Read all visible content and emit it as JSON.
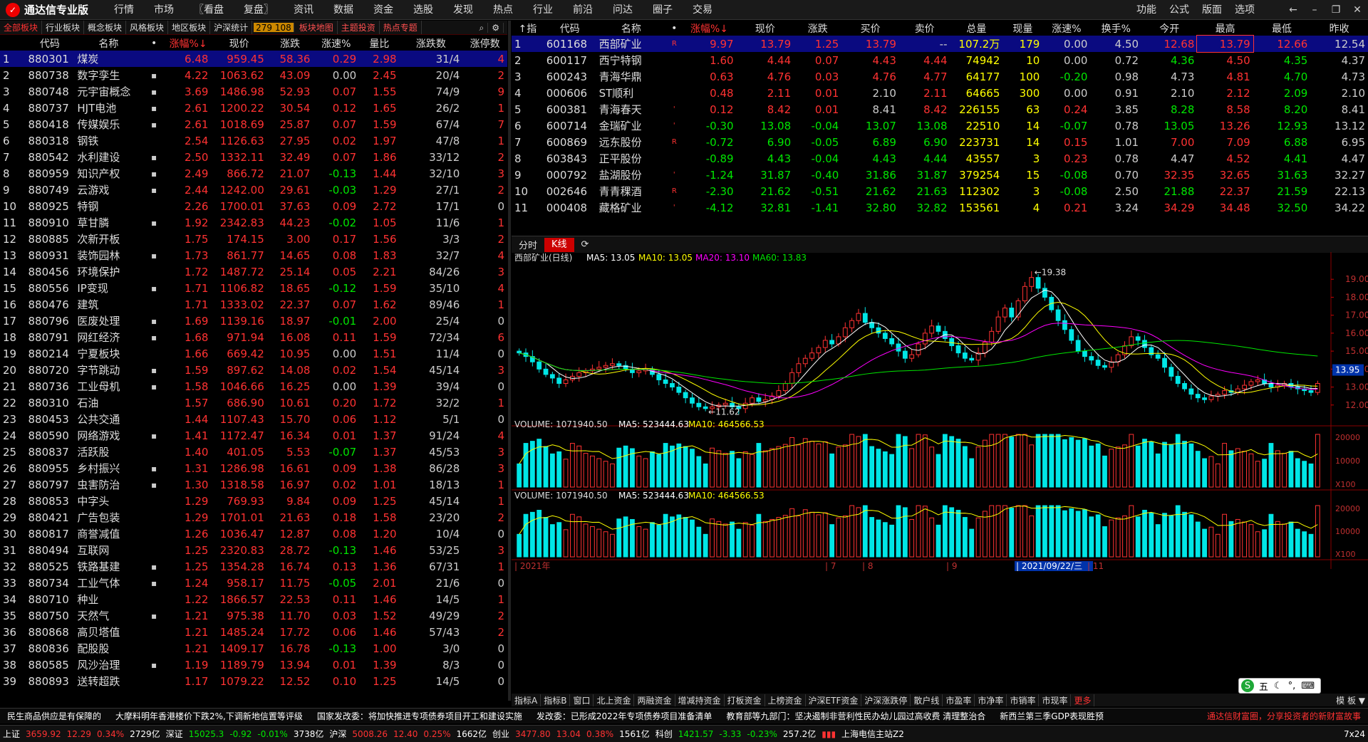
{
  "app": {
    "title": "通达信专业版",
    "logo_char": "✓"
  },
  "menu": [
    "行情",
    "市场",
    "〖看盘",
    "复盘〗",
    "资讯",
    "数据",
    "资金",
    "选股",
    "发现",
    "热点",
    "行业",
    "前沿",
    "问达",
    "圈子",
    "交易"
  ],
  "rmenu": [
    "功能",
    "公式",
    "版面",
    "选项"
  ],
  "tabs": [
    {
      "l": "全部板块",
      "act": true
    },
    {
      "l": "行业板块"
    },
    {
      "l": "概念板块"
    },
    {
      "l": "风格板块"
    },
    {
      "l": "地区板块"
    },
    {
      "l": "沪深统计"
    }
  ],
  "tab_count": "279 108",
  "tabs2": [
    "板块地图",
    "主题投资",
    "热点专题"
  ],
  "left": {
    "headers": [
      "",
      "代码",
      "名称",
      "•",
      "涨幅%↓",
      "现价",
      "涨跌",
      "涨速%",
      "量比",
      "涨跌数",
      "涨停数"
    ],
    "rows": [
      [
        "1",
        "880301",
        "煤炭",
        "",
        "6.48",
        "959.45",
        "58.36",
        "0.29",
        "2.98",
        "31/4",
        "4"
      ],
      [
        "2",
        "880738",
        "数字孪生",
        "▪",
        "4.22",
        "1063.62",
        "43.09",
        "0.00",
        "2.45",
        "20/4",
        "2"
      ],
      [
        "3",
        "880748",
        "元宇宙概念",
        "▪",
        "3.69",
        "1486.98",
        "52.93",
        "0.07",
        "1.55",
        "74/9",
        "9"
      ],
      [
        "4",
        "880737",
        "HJT电池",
        "▪",
        "2.61",
        "1200.22",
        "30.54",
        "0.12",
        "1.65",
        "26/2",
        "1"
      ],
      [
        "5",
        "880418",
        "传媒娱乐",
        "▪",
        "2.61",
        "1018.69",
        "25.87",
        "0.07",
        "1.59",
        "67/4",
        "7"
      ],
      [
        "6",
        "880318",
        "钢铁",
        "",
        "2.54",
        "1126.63",
        "27.95",
        "0.02",
        "1.97",
        "47/8",
        "1"
      ],
      [
        "7",
        "880542",
        "水利建设",
        "▪",
        "2.50",
        "1332.11",
        "32.49",
        "0.07",
        "1.86",
        "33/12",
        "2"
      ],
      [
        "8",
        "880959",
        "知识产权",
        "▪",
        "2.49",
        "866.72",
        "21.07",
        "-0.13",
        "1.44",
        "32/10",
        "3"
      ],
      [
        "9",
        "880749",
        "云游戏",
        "▪",
        "2.44",
        "1242.00",
        "29.61",
        "-0.03",
        "1.29",
        "27/1",
        "2"
      ],
      [
        "10",
        "880925",
        "特钢",
        "",
        "2.26",
        "1700.01",
        "37.63",
        "0.09",
        "2.72",
        "17/1",
        "0"
      ],
      [
        "11",
        "880910",
        "草甘膦",
        "▪",
        "1.92",
        "2342.83",
        "44.23",
        "-0.02",
        "1.05",
        "11/6",
        "1"
      ],
      [
        "12",
        "880885",
        "次新开板",
        "",
        "1.75",
        "174.15",
        "3.00",
        "0.17",
        "1.56",
        "3/3",
        "2"
      ],
      [
        "13",
        "880931",
        "装饰园林",
        "▪",
        "1.73",
        "861.77",
        "14.65",
        "0.08",
        "1.83",
        "32/7",
        "4"
      ],
      [
        "14",
        "880456",
        "环境保护",
        "",
        "1.72",
        "1487.72",
        "25.14",
        "0.05",
        "2.21",
        "84/26",
        "3"
      ],
      [
        "15",
        "880556",
        "IP变现",
        "▪",
        "1.71",
        "1106.82",
        "18.65",
        "-0.12",
        "1.59",
        "35/10",
        "4"
      ],
      [
        "16",
        "880476",
        "建筑",
        "",
        "1.71",
        "1333.02",
        "22.37",
        "0.07",
        "1.62",
        "89/46",
        "1"
      ],
      [
        "17",
        "880796",
        "医废处理",
        "▪",
        "1.69",
        "1139.16",
        "18.97",
        "-0.01",
        "2.00",
        "25/4",
        "0"
      ],
      [
        "18",
        "880791",
        "网红经济",
        "▪",
        "1.68",
        "971.94",
        "16.08",
        "0.11",
        "1.59",
        "72/34",
        "6"
      ],
      [
        "19",
        "880214",
        "宁夏板块",
        "",
        "1.66",
        "669.42",
        "10.95",
        "0.00",
        "1.51",
        "11/4",
        "0"
      ],
      [
        "20",
        "880720",
        "字节跳动",
        "▪",
        "1.59",
        "897.62",
        "14.08",
        "0.02",
        "1.54",
        "45/14",
        "3"
      ],
      [
        "21",
        "880736",
        "工业母机",
        "▪",
        "1.58",
        "1046.66",
        "16.25",
        "0.00",
        "1.39",
        "39/4",
        "0"
      ],
      [
        "22",
        "880310",
        "石油",
        "",
        "1.57",
        "686.90",
        "10.61",
        "0.20",
        "1.72",
        "32/2",
        "1"
      ],
      [
        "23",
        "880453",
        "公共交通",
        "",
        "1.44",
        "1107.43",
        "15.70",
        "0.06",
        "1.12",
        "5/1",
        "0"
      ],
      [
        "24",
        "880590",
        "网络游戏",
        "▪",
        "1.41",
        "1172.47",
        "16.34",
        "0.01",
        "1.37",
        "91/24",
        "4"
      ],
      [
        "25",
        "880837",
        "活跃股",
        "",
        "1.40",
        "401.05",
        "5.53",
        "-0.07",
        "1.37",
        "45/53",
        "3"
      ],
      [
        "26",
        "880955",
        "乡村振兴",
        "▪",
        "1.31",
        "1286.98",
        "16.61",
        "0.09",
        "1.38",
        "86/28",
        "3"
      ],
      [
        "27",
        "880797",
        "虫害防治",
        "▪",
        "1.30",
        "1318.58",
        "16.97",
        "0.02",
        "1.01",
        "18/13",
        "1"
      ],
      [
        "28",
        "880853",
        "中字头",
        "",
        "1.29",
        "769.93",
        "9.84",
        "0.09",
        "1.25",
        "45/14",
        "1"
      ],
      [
        "29",
        "880421",
        "广告包装",
        "",
        "1.29",
        "1701.01",
        "21.63",
        "0.18",
        "1.58",
        "23/20",
        "2"
      ],
      [
        "30",
        "880817",
        "商誉减值",
        "",
        "1.26",
        "1036.47",
        "12.87",
        "0.08",
        "1.20",
        "10/4",
        "0"
      ],
      [
        "31",
        "880494",
        "互联网",
        "",
        "1.25",
        "2320.83",
        "28.72",
        "-0.13",
        "1.46",
        "53/25",
        "3"
      ],
      [
        "32",
        "880525",
        "铁路基建",
        "▪",
        "1.25",
        "1354.28",
        "16.74",
        "0.13",
        "1.36",
        "67/31",
        "1"
      ],
      [
        "33",
        "880734",
        "工业气体",
        "▪",
        "1.24",
        "958.17",
        "11.75",
        "-0.05",
        "2.01",
        "21/6",
        "0"
      ],
      [
        "34",
        "880710",
        "种业",
        "",
        "1.22",
        "1866.57",
        "22.53",
        "0.11",
        "1.46",
        "14/5",
        "1"
      ],
      [
        "35",
        "880750",
        "天然气",
        "▪",
        "1.21",
        "975.38",
        "11.70",
        "0.03",
        "1.52",
        "49/29",
        "2"
      ],
      [
        "36",
        "880868",
        "高贝塔值",
        "",
        "1.21",
        "1485.24",
        "17.72",
        "0.06",
        "1.46",
        "57/43",
        "2"
      ],
      [
        "37",
        "880836",
        "配股股",
        "",
        "1.21",
        "1409.17",
        "16.78",
        "-0.13",
        "1.00",
        "3/0",
        "0"
      ],
      [
        "38",
        "880585",
        "风沙治理",
        "▪",
        "1.19",
        "1189.79",
        "13.94",
        "0.01",
        "1.39",
        "8/3",
        "0"
      ],
      [
        "39",
        "880893",
        "送转超跌",
        "",
        "1.17",
        "1079.22",
        "12.52",
        "0.10",
        "1.25",
        "14/5",
        "0"
      ]
    ]
  },
  "right": {
    "headers": [
      "↑指",
      "代码",
      "名称",
      "•",
      "涨幅%↓",
      "现价",
      "涨跌",
      "买价",
      "卖价",
      "总量",
      "现量",
      "涨速%",
      "换手%",
      "今开",
      "最高",
      "最低",
      "昨收"
    ],
    "rows": [
      [
        "1",
        "601168",
        "西部矿业",
        "R",
        "9.97",
        "13.79",
        "1.25",
        "13.79",
        "--",
        "107.2万",
        "179",
        "0.00",
        "4.50",
        "12.68",
        "13.79",
        "12.66",
        "12.54"
      ],
      [
        "2",
        "600117",
        "西宁特钢",
        "",
        "1.60",
        "4.44",
        "0.07",
        "4.43",
        "4.44",
        "74942",
        "10",
        "0.00",
        "0.72",
        "4.36",
        "4.50",
        "4.35",
        "4.37"
      ],
      [
        "3",
        "600243",
        "青海华鼎",
        "",
        "0.63",
        "4.76",
        "0.03",
        "4.76",
        "4.77",
        "64177",
        "100",
        "-0.20",
        "0.98",
        "4.73",
        "4.81",
        "4.70",
        "4.73"
      ],
      [
        "4",
        "000606",
        "ST顺利",
        "",
        "0.48",
        "2.11",
        "0.01",
        "2.10",
        "2.11",
        "64665",
        "300",
        "0.00",
        "0.91",
        "2.10",
        "2.12",
        "2.09",
        "2.10"
      ],
      [
        "5",
        "600381",
        "青海春天",
        "'",
        "0.12",
        "8.42",
        "0.01",
        "8.41",
        "8.42",
        "226155",
        "63",
        "0.24",
        "3.85",
        "8.28",
        "8.58",
        "8.20",
        "8.41"
      ],
      [
        "6",
        "600714",
        "金瑞矿业",
        "'",
        "-0.30",
        "13.08",
        "-0.04",
        "13.07",
        "13.08",
        "22510",
        "14",
        "-0.07",
        "0.78",
        "13.05",
        "13.26",
        "12.93",
        "13.12"
      ],
      [
        "7",
        "600869",
        "远东股份",
        "R",
        "-0.72",
        "6.90",
        "-0.05",
        "6.89",
        "6.90",
        "223731",
        "14",
        "0.15",
        "1.01",
        "7.00",
        "7.09",
        "6.88",
        "6.95"
      ],
      [
        "8",
        "603843",
        "正平股份",
        "",
        "-0.89",
        "4.43",
        "-0.04",
        "4.43",
        "4.44",
        "43557",
        "3",
        "0.23",
        "0.78",
        "4.47",
        "4.52",
        "4.41",
        "4.47"
      ],
      [
        "9",
        "000792",
        "盐湖股份",
        "'",
        "-1.24",
        "31.87",
        "-0.40",
        "31.86",
        "31.87",
        "379254",
        "15",
        "-0.08",
        "0.70",
        "32.35",
        "32.65",
        "31.63",
        "32.27"
      ],
      [
        "10",
        "002646",
        "青青稞酒",
        "R",
        "-2.30",
        "21.62",
        "-0.51",
        "21.62",
        "21.63",
        "112302",
        "3",
        "-0.08",
        "2.50",
        "21.88",
        "22.37",
        "21.59",
        "22.13"
      ],
      [
        "11",
        "000408",
        "藏格矿业",
        "'",
        "-4.12",
        "32.81",
        "-1.41",
        "32.80",
        "32.82",
        "153561",
        "4",
        "0.21",
        "3.24",
        "34.29",
        "34.48",
        "32.50",
        "34.22"
      ]
    ]
  },
  "kbar": {
    "tab1": "分时",
    "tab2": "K线"
  },
  "chart_data": {
    "type": "candlestick",
    "title": "西部矿业(日线)",
    "ma_labels": {
      "ma5": "MA5: 13.05",
      "ma10": "MA10: 13.05",
      "ma20": "MA20: 13.10",
      "ma60": "MA60: 13.83"
    },
    "volume_label": "VOLUME: 1071940.50",
    "vol_ma5": "MA5: 523444.63",
    "vol_ma10": "MA10: 464566.53",
    "high_mark": "19.38",
    "low_mark": "11.62",
    "last_price": "13.95",
    "y_ticks": [
      19.0,
      18.0,
      17.0,
      16.0,
      15.0,
      14.0,
      13.0,
      12.0
    ],
    "ylim": [
      11.0,
      19.8
    ],
    "vol_ticks": [
      "20000",
      "10000",
      "X100"
    ],
    "x_labels": [
      "2021年",
      "7",
      "8",
      "9",
      "2021/09/22/三",
      "11"
    ],
    "close": [
      14.9,
      14.7,
      14.4,
      14.0,
      13.7,
      13.5,
      13.2,
      13.4,
      13.6,
      13.8,
      13.9,
      14.0,
      14.1,
      14.2,
      14.3,
      14.2,
      14.0,
      13.8,
      13.9,
      14.0,
      13.7,
      13.4,
      13.2,
      13.0,
      12.7,
      12.4,
      12.1,
      11.9,
      11.8,
      11.9,
      12.0,
      12.1,
      11.9,
      11.8,
      12.1,
      12.4,
      12.2,
      12.3,
      12.5,
      12.8,
      13.2,
      13.8,
      14.3,
      14.6,
      14.9,
      15.2,
      15.6,
      15.4,
      15.8,
      16.3,
      16.7,
      17.1,
      16.6,
      16.3,
      16.0,
      15.7,
      15.4,
      15.0,
      14.6,
      14.8,
      15.4,
      16.0,
      16.4,
      16.1,
      15.7,
      15.3,
      14.9,
      14.6,
      14.5,
      14.9,
      15.5,
      16.1,
      16.9,
      17.4,
      16.9,
      17.8,
      18.6,
      19.1,
      18.5,
      18.0,
      17.3,
      16.7,
      16.2,
      15.6,
      15.0,
      14.7,
      14.5,
      14.2,
      14.1,
      14.4,
      14.8,
      15.3,
      15.8,
      15.6,
      15.2,
      14.8,
      14.6,
      14.1,
      13.6,
      13.2,
      12.9,
      12.6,
      12.4,
      12.3,
      12.5,
      12.6,
      12.8,
      12.7,
      12.9,
      13.1,
      13.3,
      13.4,
      13.2,
      13.0,
      13.1,
      13.2,
      13.0,
      12.9,
      12.8,
      12.7,
      13.2
    ]
  },
  "bottom_tabs": [
    "指标A",
    "指标B",
    "窗口",
    "北上资金",
    "两融资金",
    "增减持资金",
    "打板资金",
    "上榜资金",
    "沪深ETF资金",
    "沪深涨跌停",
    "散户线",
    "市盈率",
    "市净率",
    "市销率",
    "市现率"
  ],
  "bottom_more": "更多",
  "bottom_right": "模 板 ▼",
  "ticker": [
    "民生商品供应是有保障的",
    "大摩料明年香港楼价下跌2%,下调新地信置等评级",
    "国家发改委：将加快推进专项债券项目开工和建设实施",
    "发改委：已形成2022年专项债券项目准备清单",
    "教育部等九部门：坚决遏制非营利性民办幼儿园过高收费 清理整治合",
    "新西兰第三季GDP表现胜预"
  ],
  "slogan": "通达信财富圈，分享投资者的新财富故事",
  "status": {
    "sh": "上证",
    "sh_v": "3659.92",
    "sh_c": "12.29",
    "sh_p": "0.34%",
    "sh_a": "2729亿",
    "sz": "深证",
    "sz_v": "15025.3",
    "sz_c": "-0.92",
    "sz_p": "-0.01%",
    "sz_a": "3738亿",
    "hs": "沪深",
    "hs_v": "5008.26",
    "hs_c": "12.40",
    "hs_p": "0.25%",
    "hs_a": "1662亿",
    "cy": "创业",
    "cy_v": "3477.80",
    "cy_c": "13.04",
    "cy_p": "0.38%",
    "cy_a": "1561亿",
    "kc": "科创",
    "kc_v": "1421.57",
    "kc_c": "-3.33",
    "kc_p": "-0.23%",
    "kc_a": "257.2亿",
    "server": "上海电信主站Z2",
    "time": "7x24"
  },
  "ime": {
    "icon": "S",
    "label": "五"
  }
}
